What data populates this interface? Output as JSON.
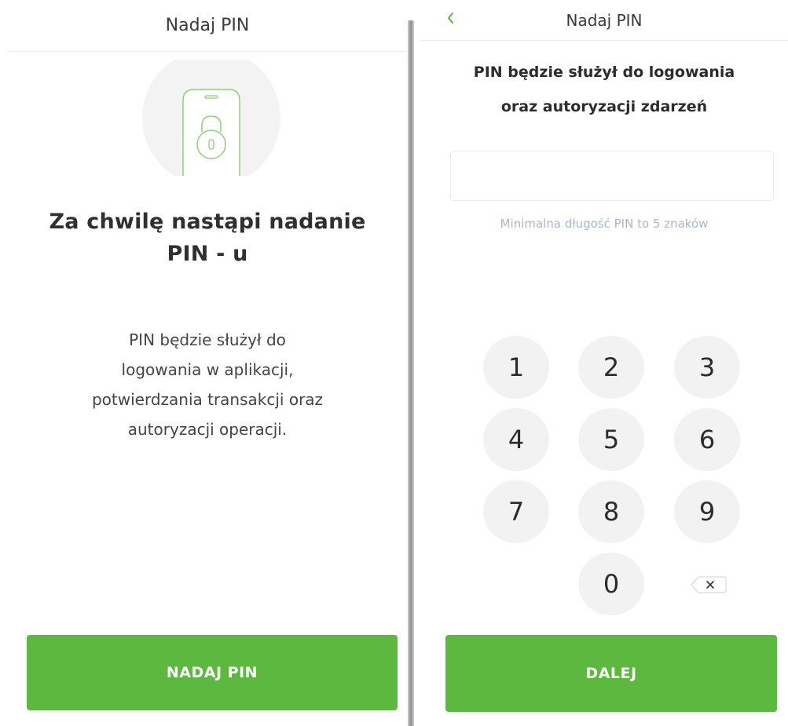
{
  "left": {
    "header_title": "Nadaj PIN",
    "title_line1": "Za chwilę nastąpi nadanie",
    "title_line2": "PIN - u",
    "description": {
      "line1": "PIN będzie służył do",
      "line2": "logowania w aplikacji,",
      "line3": "potwierdzania transakcji oraz",
      "line4": "autoryzacji operacji."
    },
    "button_label": "NADAJ PIN",
    "illustration_icon": "phone-lock-icon"
  },
  "right": {
    "header_title": "Nadaj PIN",
    "back_icon": "chevron-left-icon",
    "title_line1": "PIN będzie służył do logowania",
    "title_line2": "oraz autoryzacji zdarzeń",
    "pin_input": {
      "value": "",
      "placeholder": ""
    },
    "hint": "Minimalna długość PIN to 5 znaków",
    "keys": [
      "1",
      "2",
      "3",
      "4",
      "5",
      "6",
      "7",
      "8",
      "9",
      "0"
    ],
    "backspace_icon": "backspace-icon",
    "button_label": "DALEJ"
  },
  "colors": {
    "accent_green": "#5cb83f",
    "hint_text": "#a9b6cf",
    "key_background": "#f2f2f2",
    "illustration_circle": "#f3f3f3"
  }
}
